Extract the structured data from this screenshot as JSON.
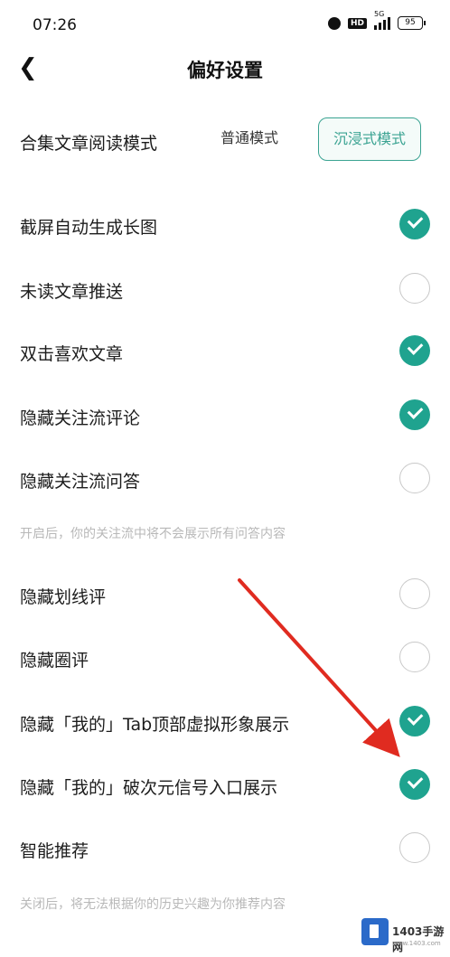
{
  "status_bar": {
    "time": "07:26",
    "network": "5G",
    "hd": "HD",
    "battery": "95"
  },
  "header": {
    "title": "偏好设置"
  },
  "reading_mode": {
    "label": "合集文章阅读模式",
    "options": [
      "普通模式",
      "沉浸式模式"
    ],
    "selected": "沉浸式模式"
  },
  "settings": [
    {
      "label": "截屏自动生成长图",
      "checked": true
    },
    {
      "label": "未读文章推送",
      "checked": false
    },
    {
      "label": "双击喜欢文章",
      "checked": true
    },
    {
      "label": "隐藏关注流评论",
      "checked": true
    },
    {
      "label": "隐藏关注流问答",
      "checked": false
    },
    {
      "label": "隐藏划线评",
      "checked": false
    },
    {
      "label": "隐藏圈评",
      "checked": false
    },
    {
      "label": "隐藏「我的」Tab顶部虚拟形象展示",
      "checked": true
    },
    {
      "label": "隐藏「我的」破次元信号入口展示",
      "checked": true
    },
    {
      "label": "智能推荐",
      "checked": false
    }
  ],
  "notes": {
    "qa": "开启后，你的关注流中将不会展示所有问答内容",
    "recommend": "关闭后，将无法根据你的历史兴趣为你推荐内容"
  },
  "annotation": {
    "arrow_color": "#e02b20"
  },
  "watermark": {
    "text": "1403手游网",
    "sub": "www.1403.com"
  },
  "colors": {
    "accent": "#1fa38f"
  }
}
